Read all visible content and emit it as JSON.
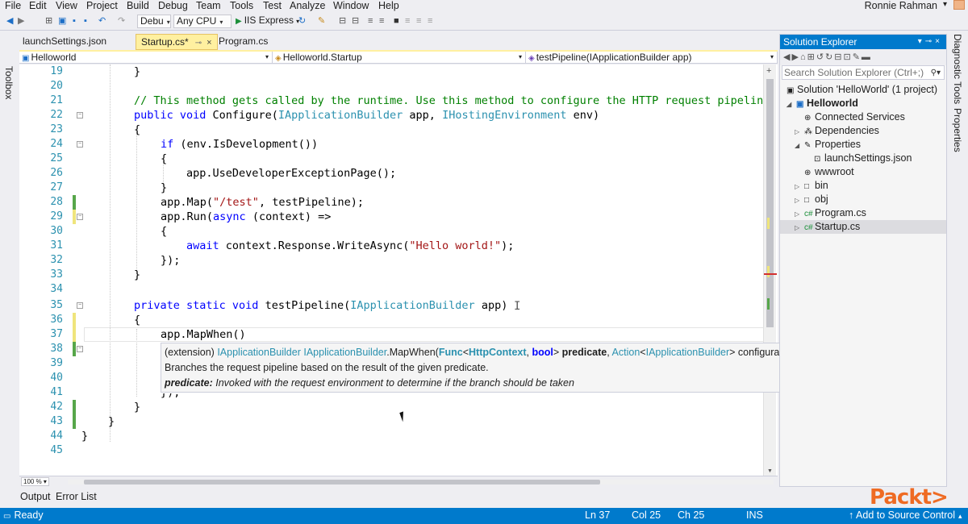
{
  "menu": {
    "items": [
      "File",
      "Edit",
      "View",
      "Project",
      "Build",
      "Debug",
      "Team",
      "Tools",
      "Test",
      "Analyze",
      "Window",
      "Help"
    ],
    "user": "Ronnie Rahman"
  },
  "toolbar": {
    "config": "Debu",
    "platform": "Any CPU",
    "run_target": "IIS Express"
  },
  "toolbox": {
    "label": "Toolbox"
  },
  "tabs": [
    {
      "label": "launchSettings.json"
    },
    {
      "label": "Startup.cs*"
    },
    {
      "label": "Program.cs"
    }
  ],
  "nav": {
    "project": "Helloworld",
    "class": "Helloworld.Startup",
    "member": "testPipeline(IApplicationBuilder app)"
  },
  "editor": {
    "line_numbers": [
      "19",
      "20",
      "21",
      "22",
      "23",
      "24",
      "25",
      "26",
      "27",
      "28",
      "29",
      "30",
      "31",
      "32",
      "33",
      "34",
      "35",
      "36",
      "37",
      "38",
      "39",
      "40",
      "41",
      "42",
      "43",
      "44",
      "45"
    ],
    "lines": {
      "l19": "}",
      "l21": "// This method gets called by the runtime. Use this method to configure the HTTP request pipelin",
      "l22_kw": "public void",
      "l22_a": "Configure(",
      "l22_t1": "IApplicationBuilder",
      "l22_b": "app,",
      "l22_t2": "IHostingEnvironment",
      "l22_c": "env)",
      "l23": "{",
      "l24_kw": "if",
      "l24_rest": "(env.IsDevelopment())",
      "l25": "{",
      "l26": "app.UseDeveloperExceptionPage();",
      "l27": "}",
      "l28_a": "app.Map(",
      "l28_s": "\"/test\"",
      "l28_b": ", testPipeline);",
      "l29_a": "app.Run(",
      "l29_kw": "async",
      "l29_b": "(context) =>",
      "l30": "{",
      "l31_kw": "await",
      "l31_a": "context.Response.WriteAsync(",
      "l31_s": "\"Hello world!\"",
      "l31_b": ");",
      "l32": "});",
      "l33": "}",
      "l35_kw": "private static void",
      "l35_a": "testPipeline(",
      "l35_t": "IApplicationBuilder",
      "l35_b": "app)",
      "l36": "{",
      "l37": "app.MapWhen()",
      "l41": "});",
      "l42": "}",
      "l43": "}",
      "l44": "}"
    },
    "zoom": "100 %"
  },
  "tooltip": {
    "l1_prefix": "(extension)",
    "l1_type1": "IApplicationBuilder",
    "l1_type2": "IApplicationBuilder",
    "l1_method": ".MapWhen(",
    "l1_func": "Func",
    "l1_lt": "<",
    "l1_ctx": "HttpContext",
    "l1_comma": ",",
    "l1_bool": "bool",
    "l1_gt": ">",
    "l1_predicate": "predicate",
    "l1_sep": ",",
    "l1_action": "Action",
    "l1_lt2": "<",
    "l1_iab": "IApplicationBuilder",
    "l1_end": "> configuration)",
    "l2": "Branches the request pipeline based on the result of the given predicate.",
    "l3_label": "predicate:",
    "l3_text": "Invoked with the request environment to determine if the branch should be taken"
  },
  "solution_explorer": {
    "title": "Solution Explorer",
    "search_placeholder": "Search Solution Explorer (Ctrl+;)",
    "items": [
      {
        "label": "Solution 'HelloWorld' (1 project)"
      },
      {
        "label": "Helloworld"
      },
      {
        "label": "Connected Services"
      },
      {
        "label": "Dependencies"
      },
      {
        "label": "Properties"
      },
      {
        "label": "launchSettings.json"
      },
      {
        "label": "wwwroot"
      },
      {
        "label": "bin"
      },
      {
        "label": "obj"
      },
      {
        "label": "Program.cs"
      },
      {
        "label": "Startup.cs"
      }
    ]
  },
  "right_strip": {
    "diag": "Diagnostic Tools",
    "props": "Properties"
  },
  "bottom_tabs": {
    "output": "Output",
    "errors": "Error List"
  },
  "status": {
    "ready": "Ready",
    "ln": "Ln 37",
    "col": "Col 25",
    "ch": "Ch 25",
    "ins": "INS",
    "source_control": "Add to Source Control"
  },
  "logo": "Packt>"
}
